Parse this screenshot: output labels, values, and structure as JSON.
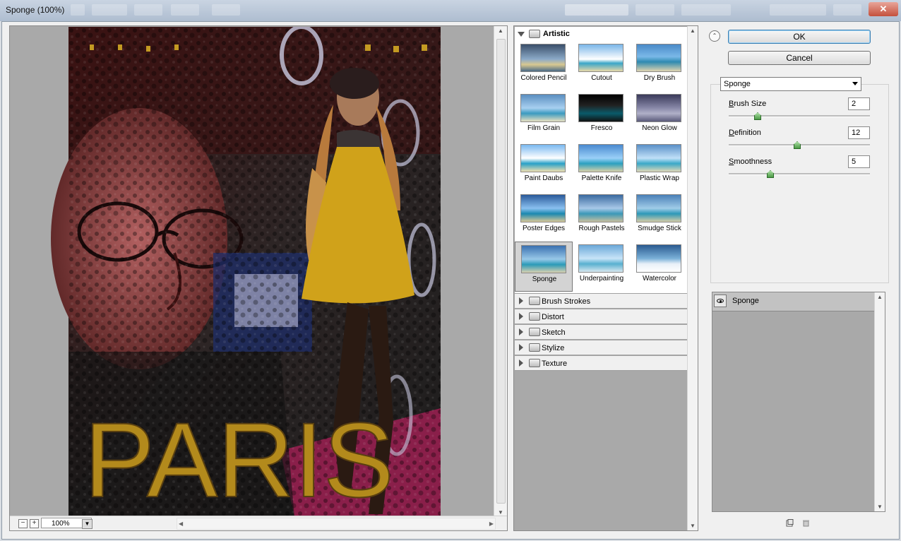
{
  "window": {
    "title": "Sponge (100%)"
  },
  "preview": {
    "zoom_value": "100%",
    "zoom_out_label": "−",
    "zoom_in_label": "+",
    "image_text": "PARIS"
  },
  "categories": {
    "artistic": {
      "label": "Artistic",
      "filters": [
        "Colored Pencil",
        "Cutout",
        "Dry Brush",
        "Film Grain",
        "Fresco",
        "Neon Glow",
        "Paint Daubs",
        "Palette Knife",
        "Plastic Wrap",
        "Poster Edges",
        "Rough Pastels",
        "Smudge Stick",
        "Sponge",
        "Underpainting",
        "Watercolor"
      ],
      "selected": "Sponge"
    },
    "collapsed": [
      "Brush Strokes",
      "Distort",
      "Sketch",
      "Stylize",
      "Texture"
    ]
  },
  "buttons": {
    "ok": "OK",
    "cancel": "Cancel"
  },
  "filter_select": {
    "value": "Sponge"
  },
  "params": [
    {
      "label": "Brush Size",
      "mnemonic": "B",
      "rest": "rush Size",
      "value": "2",
      "position": 0.2
    },
    {
      "label": "Definition",
      "mnemonic": "D",
      "rest": "efinition",
      "value": "12",
      "position": 0.48
    },
    {
      "label": "Smoothness",
      "mnemonic": "S",
      "rest": "moothness",
      "value": "5",
      "position": 0.29
    }
  ],
  "layers": [
    {
      "name": "Sponge",
      "visible": true
    }
  ],
  "colors": {
    "selected_thumb_bg": "#d3d3d3",
    "panel_gray": "#a9a9a9",
    "dialog_bg": "#f0f0f0"
  }
}
